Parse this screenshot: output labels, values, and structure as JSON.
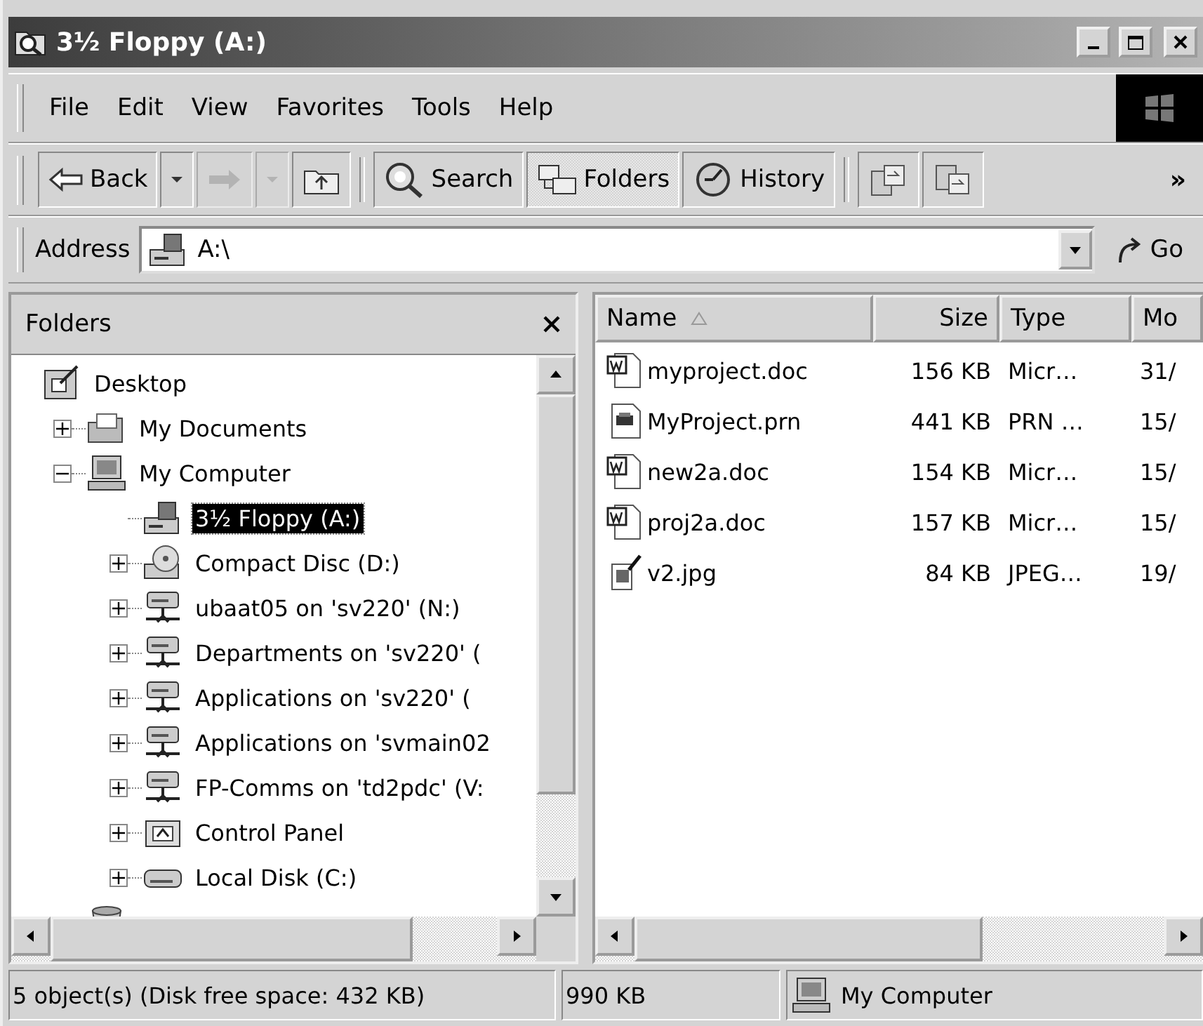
{
  "window": {
    "title": "3½ Floppy (A:)"
  },
  "menu": [
    "File",
    "Edit",
    "View",
    "Favorites",
    "Tools",
    "Help"
  ],
  "toolbar": [
    {
      "kind": "back",
      "label": "Back",
      "disabled": false
    },
    {
      "kind": "dropdown",
      "disabled": false
    },
    {
      "kind": "forward",
      "disabled": true
    },
    {
      "kind": "dropdown",
      "disabled": true
    },
    {
      "kind": "up",
      "disabled": false
    },
    {
      "kind": "separator"
    },
    {
      "kind": "search",
      "label": "Search",
      "pressed": false
    },
    {
      "kind": "folders",
      "label": "Folders",
      "pressed": true
    },
    {
      "kind": "history",
      "label": "History",
      "pressed": false
    },
    {
      "kind": "separator"
    },
    {
      "kind": "move"
    },
    {
      "kind": "copy"
    }
  ],
  "toolbar_more": "»",
  "address": {
    "label": "Address",
    "value": "A:\\",
    "go": "Go"
  },
  "folders_pane": {
    "title": "Folders"
  },
  "tree": [
    {
      "label": "Desktop",
      "kind": "desktop",
      "selected": false,
      "children": [
        {
          "label": "My Documents",
          "kind": "documents",
          "expanded": false,
          "selected": false
        },
        {
          "label": "My Computer",
          "kind": "computer",
          "expanded": true,
          "selected": false,
          "children": [
            {
              "label": "3½ Floppy (A:)",
              "kind": "floppy",
              "selected": true
            },
            {
              "label": "Compact Disc (D:)",
              "kind": "cd",
              "expanded": false,
              "selected": false
            },
            {
              "label": "ubaat05 on 'sv220' (N:)",
              "kind": "network",
              "expanded": false,
              "selected": false
            },
            {
              "label": "Departments on 'sv220' (",
              "kind": "network",
              "expanded": false,
              "selected": false
            },
            {
              "label": "Applications on 'sv220' (",
              "kind": "network",
              "expanded": false,
              "selected": false
            },
            {
              "label": "Applications on 'svmain02",
              "kind": "network",
              "expanded": false,
              "selected": false
            },
            {
              "label": "FP-Comms on 'td2pdc' (V:",
              "kind": "network",
              "expanded": false,
              "selected": false
            },
            {
              "label": "Control Panel",
              "kind": "control",
              "expanded": false,
              "selected": false
            },
            {
              "label": "Local Disk (C:)",
              "kind": "disk",
              "expanded": false,
              "selected": false
            }
          ]
        },
        {
          "kind": "recycle"
        }
      ]
    }
  ],
  "file_list": {
    "columns": [
      {
        "label": "Name",
        "sorted": true
      },
      {
        "label": "Size"
      },
      {
        "label": "Type"
      },
      {
        "label": "Mo"
      }
    ],
    "rows": [
      {
        "kind": "word",
        "name": "myproject.doc",
        "size": "156 KB",
        "type": "Micr…",
        "modified": "31/"
      },
      {
        "kind": "print",
        "name": "MyProject.prn",
        "size": "441 KB",
        "type": "PRN …",
        "modified": "15/"
      },
      {
        "kind": "word",
        "name": "new2a.doc",
        "size": "154 KB",
        "type": "Micr…",
        "modified": "15/"
      },
      {
        "kind": "word",
        "name": "proj2a.doc",
        "size": "157 KB",
        "type": "Micr…",
        "modified": "15/"
      },
      {
        "kind": "image",
        "name": "v2.jpg",
        "size": "84 KB",
        "type": "JPEG…",
        "modified": "19/"
      }
    ]
  },
  "status_bar": {
    "objects": "5 object(s) (Disk free space: 432 KB)",
    "size": "990 KB",
    "zone": "My Computer"
  }
}
